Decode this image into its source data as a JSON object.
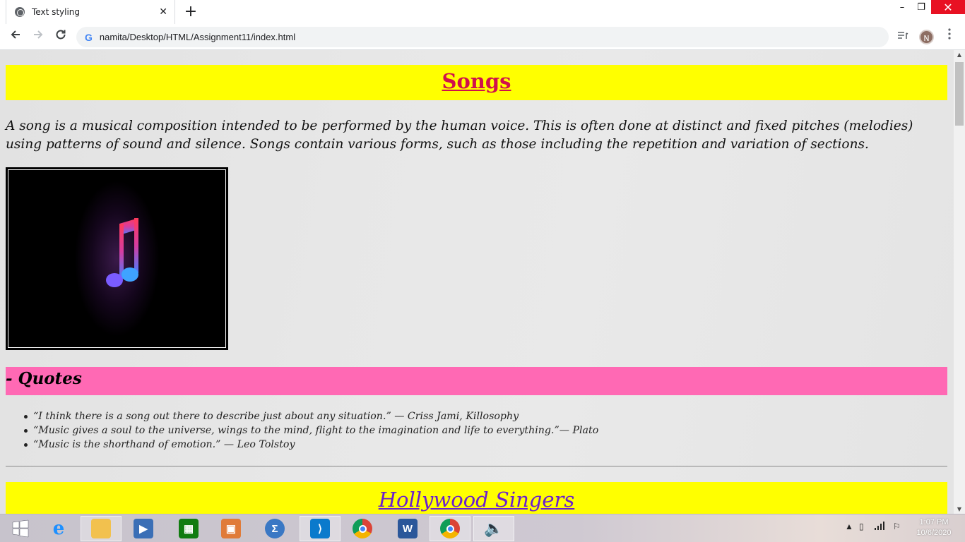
{
  "browser": {
    "tab_title": "Text styling",
    "tab_close": "✕",
    "new_tab": "+",
    "url": "namita/Desktop/HTML/Assignment11/index.html",
    "profile_initial": "N",
    "window_controls": {
      "minimize": "–",
      "maximize": "❐",
      "close": "✕"
    }
  },
  "page": {
    "heading": "Songs",
    "intro": "A song is a musical composition intended to be performed by the human voice. This is often done at distinct and fixed pitches (melodies) using patterns of sound and silence. Songs contain various forms, such as those including the repetition and variation of sections.",
    "quotes_heading": "- Quotes",
    "quotes": [
      "“I think there is a song out there to describe just about any situation.” — Criss Jami, Killosophy",
      "“Music gives a soul to the universe, wings to the mind, flight to the imagination and life to everything.”— Plato",
      "“Music is the shorthand of emotion.” — Leo Tolstoy"
    ],
    "second_heading": "Hollywood Singers"
  },
  "taskbar": {
    "clock_time": "1:07 PM",
    "clock_date": "10/6/2020"
  },
  "colors": {
    "heading_bg": "#ffff00",
    "songs_text": "#d0104c",
    "quotes_bg": "#ff69b4",
    "hollywood_text": "#6a1fd0"
  }
}
